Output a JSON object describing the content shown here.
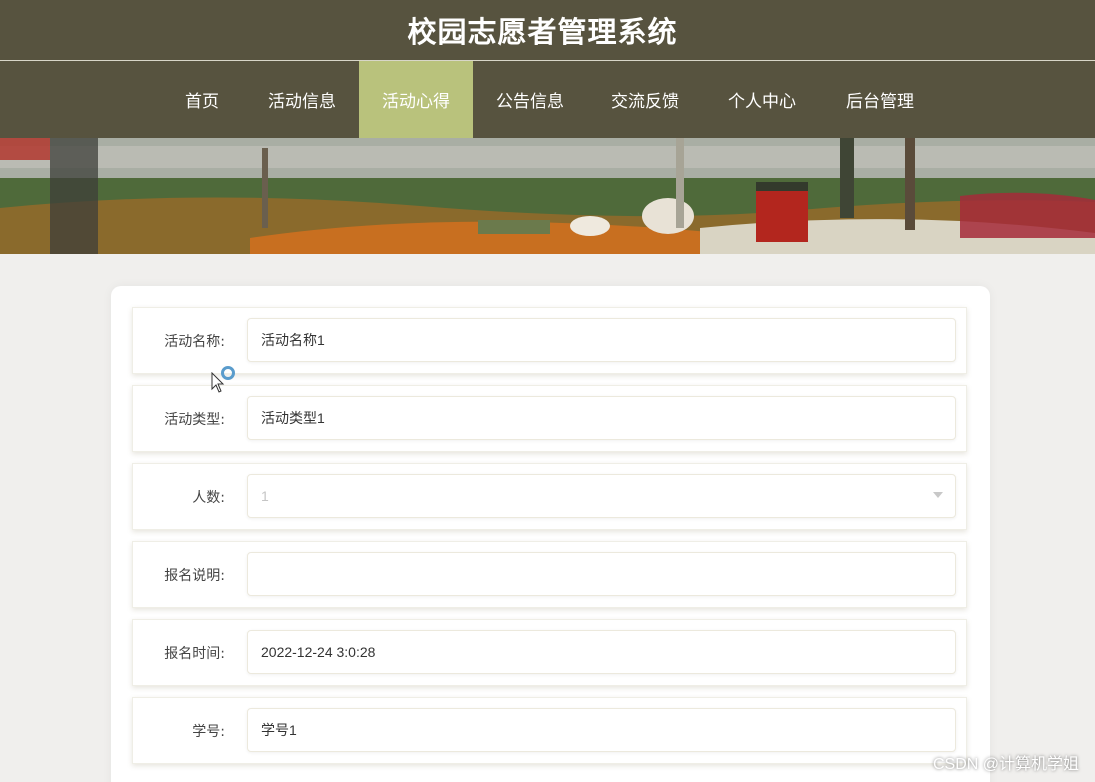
{
  "site": {
    "title": "校园志愿者管理系统"
  },
  "nav": {
    "items": [
      {
        "label": "首页"
      },
      {
        "label": "活动信息"
      },
      {
        "label": "活动心得",
        "active": true
      },
      {
        "label": "公告信息"
      },
      {
        "label": "交流反馈"
      },
      {
        "label": "个人中心"
      },
      {
        "label": "后台管理"
      }
    ]
  },
  "form": {
    "fields": [
      {
        "label": "活动名称:",
        "value": "活动名称1"
      },
      {
        "label": "活动类型:",
        "value": "活动类型1"
      },
      {
        "label": "人数:",
        "value": "1",
        "type": "select"
      },
      {
        "label": "报名说明:",
        "value": ""
      },
      {
        "label": "报名时间:",
        "value": "2022-12-24 3:0:28"
      },
      {
        "label": "学号:",
        "value": "学号1"
      }
    ]
  },
  "watermark": "CSDN @计算机学姐",
  "colors": {
    "header_bg": "#57533f",
    "nav_active_bg": "#b9c27c",
    "page_bg": "#f0efed"
  }
}
